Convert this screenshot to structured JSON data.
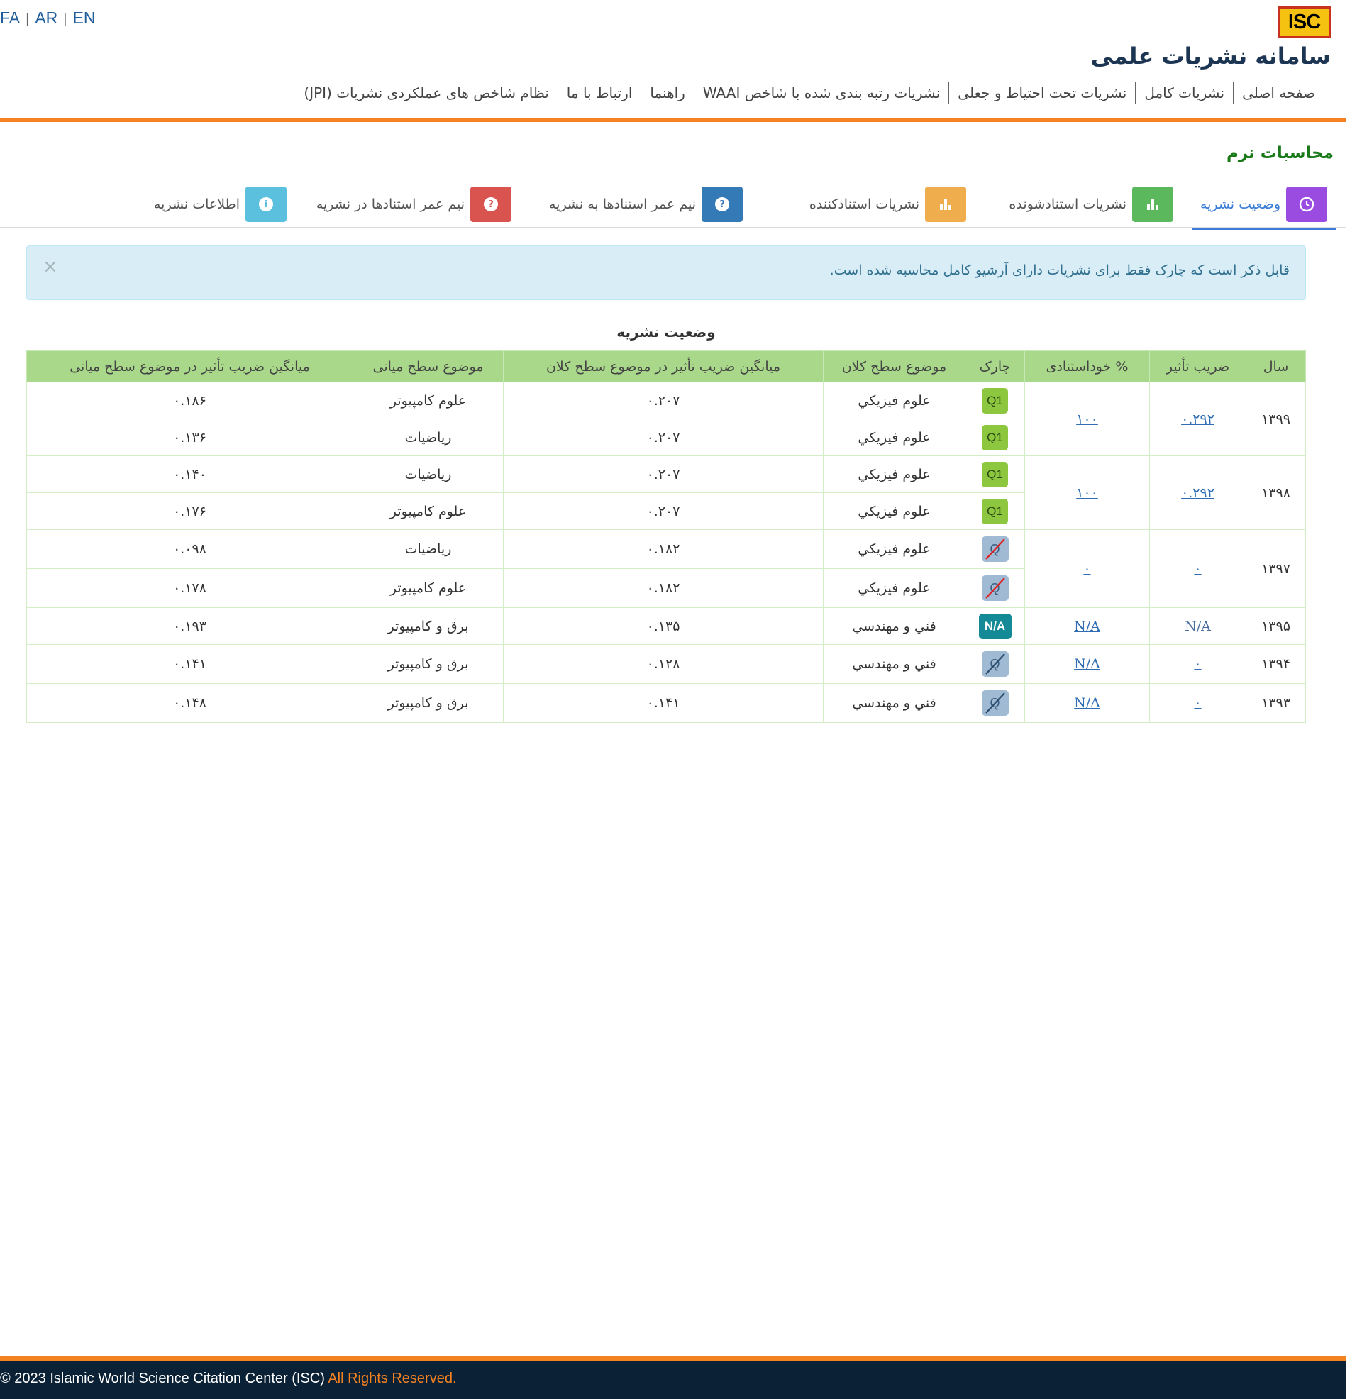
{
  "header": {
    "languages": [
      "FA",
      "AR",
      "EN"
    ],
    "logo_text": "ISC",
    "site_title": "سامانه نشریات علمی",
    "nav": [
      "صفحه اصلی",
      "نشریات کامل",
      "نشریات تحت احتیاط و جعلی",
      "نشریات رتبه بندی شده با شاخص WAAI",
      "راهنما",
      "ارتباط با ما",
      "نظام شاخص های عملکردی نشریات (JPI)"
    ]
  },
  "section_title": "محاسبات نرم",
  "tabs": [
    {
      "label": "وضعیت نشریه",
      "icon": "clock-icon",
      "active": true
    },
    {
      "label": "نشریات استنادشونده",
      "icon": "bar-chart-icon"
    },
    {
      "label": "نشریات استنادکننده",
      "icon": "bar-chart-icon"
    },
    {
      "label": "نیم عمر استنادها به نشریه",
      "icon": "question-circle-icon"
    },
    {
      "label": "نیم عمر استنادها در نشریه",
      "icon": "question-circle-icon"
    },
    {
      "label": "اطلاعات نشریه",
      "icon": "info-circle-icon"
    }
  ],
  "alert": {
    "message": "قابل ذکر است که چارک فقط برای نشریات دارای آرشیو کامل محاسبه شده است.",
    "close": "×"
  },
  "table": {
    "caption": "وضعیت نشریه",
    "headers": {
      "year": "سال",
      "impact": "ضریب تأثیر",
      "self_cite": "% خوداستنادی",
      "quartile": "چارک",
      "macro_subject": "موضوع سطح کلان",
      "macro_avg": "میانگین ضریب تأثیر در موضوع سطح کلان",
      "mid_subject": "موضوع سطح میانی",
      "mid_avg": "میانگین ضریب تأثیر در موضوع سطح میانی"
    },
    "groups": [
      {
        "year": "۱۳۹۹",
        "impact": "۰.۲۹۲",
        "impact_link": true,
        "self_cite": "۱۰۰",
        "rows": [
          {
            "quartile": "Q1",
            "macro_subject": "علوم فيزيكي",
            "macro_avg": "۰.۲۰۷",
            "mid_subject": "علوم کامپیوتر",
            "mid_avg": "۰.۱۸۶"
          },
          {
            "quartile": "Q1",
            "macro_subject": "علوم فيزيكي",
            "macro_avg": "۰.۲۰۷",
            "mid_subject": "ریاضیات",
            "mid_avg": "۰.۱۳۶"
          }
        ]
      },
      {
        "year": "۱۳۹۸",
        "impact": "۰.۲۹۲",
        "impact_link": true,
        "self_cite": "۱۰۰",
        "rows": [
          {
            "quartile": "Q1",
            "macro_subject": "علوم فيزيكي",
            "macro_avg": "۰.۲۰۷",
            "mid_subject": "ریاضیات",
            "mid_avg": "۰.۱۴۰"
          },
          {
            "quartile": "Q1",
            "macro_subject": "علوم فيزيكي",
            "macro_avg": "۰.۲۰۷",
            "mid_subject": "علوم کامپیوتر",
            "mid_avg": "۰.۱۷۶"
          }
        ]
      },
      {
        "year": "۱۳۹۷",
        "impact": "۰",
        "impact_link": true,
        "self_cite": "۰",
        "rows": [
          {
            "quartile": "Q",
            "quartile_style": "none-red",
            "macro_subject": "علوم فيزيكي",
            "macro_avg": "۰.۱۸۲",
            "mid_subject": "ریاضیات",
            "mid_avg": "۰.۰۹۸"
          },
          {
            "quartile": "Q",
            "quartile_style": "none-red",
            "macro_subject": "علوم فيزيكي",
            "macro_avg": "۰.۱۸۲",
            "mid_subject": "علوم کامپیوتر",
            "mid_avg": "۰.۱۷۸"
          }
        ]
      },
      {
        "year": "۱۳۹۵",
        "impact": "N/A",
        "impact_link": false,
        "self_cite": "N/A",
        "rows": [
          {
            "quartile": "N/A",
            "quartile_style": "na",
            "macro_subject": "فني و مهندسي",
            "macro_avg": "۰.۱۳۵",
            "mid_subject": "برق و کامپیوتر",
            "mid_avg": "۰.۱۹۳"
          }
        ]
      },
      {
        "year": "۱۳۹۴",
        "impact": "۰",
        "impact_link": true,
        "self_cite": "N/A",
        "rows": [
          {
            "quartile": "Q",
            "quartile_style": "none-blue",
            "macro_subject": "فني و مهندسي",
            "macro_avg": "۰.۱۲۸",
            "mid_subject": "برق و کامپیوتر",
            "mid_avg": "۰.۱۴۱"
          }
        ]
      },
      {
        "year": "۱۳۹۳",
        "impact": "۰",
        "impact_link": true,
        "self_cite": "N/A",
        "rows": [
          {
            "quartile": "Q",
            "quartile_style": "none-blue",
            "macro_subject": "فني و مهندسي",
            "macro_avg": "۰.۱۴۱",
            "mid_subject": "برق و کامپیوتر",
            "mid_avg": "۰.۱۴۸"
          }
        ]
      }
    ]
  },
  "footer": {
    "copyright": "© 2023 Islamic World Science Citation Center (ISC)",
    "rights": "All Rights Reserved."
  },
  "colors": {
    "accent_orange": "#f58220",
    "header_green": "#a9d88b",
    "footer_bg": "#0b2136",
    "link_blue": "#2f6eb5"
  }
}
